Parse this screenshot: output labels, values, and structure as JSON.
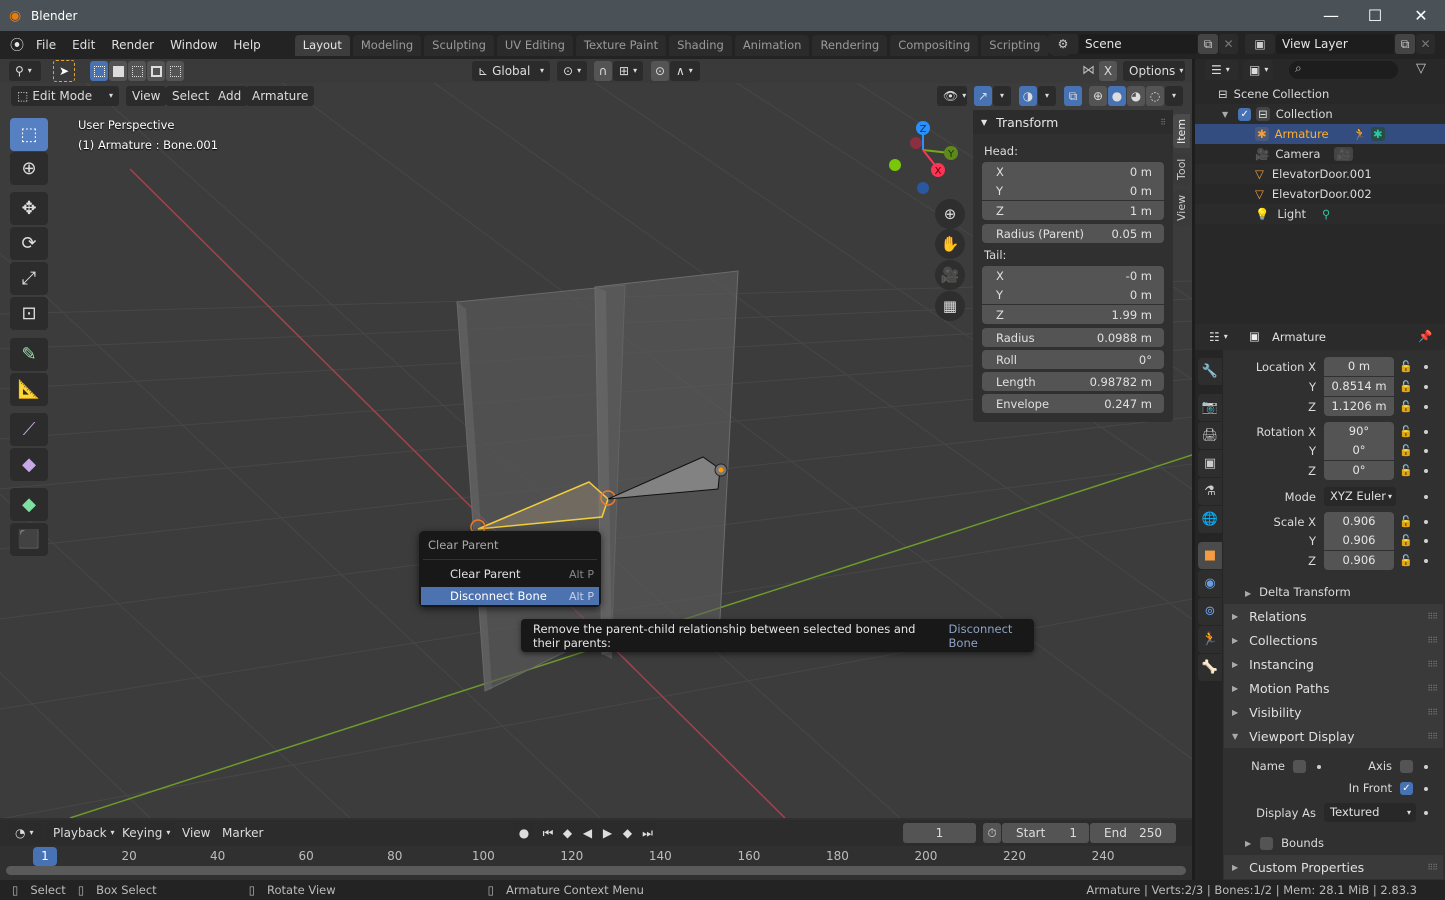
{
  "window": {
    "title": "Blender",
    "controls": [
      "minimize",
      "maximize",
      "close"
    ]
  },
  "menubar": {
    "menus": [
      "File",
      "Edit",
      "Render",
      "Window",
      "Help"
    ],
    "workspaces": [
      "Layout",
      "Modeling",
      "Sculpting",
      "UV Editing",
      "Texture Paint",
      "Shading",
      "Animation",
      "Rendering",
      "Compositing",
      "Scripting"
    ],
    "active_workspace": "Layout",
    "add_workspace": "+",
    "scene": "Scene",
    "view_layer": "View Layer"
  },
  "viewport_header": {
    "transform_orientation": "Global",
    "options_label": "Options",
    "mirror_x": "X",
    "mode": "Edit Mode",
    "menus": [
      "View",
      "Select",
      "Add",
      "Armature"
    ]
  },
  "viewport": {
    "perspective_label": "User Perspective",
    "object_label": "(1) Armature : Bone.001",
    "gizmo_axes": {
      "x": "X",
      "y": "Y",
      "z": "Z",
      "colors": {
        "x": "#ff3352",
        "y": "#8bdc00",
        "z": "#2890ff"
      }
    },
    "nav_buttons": [
      "zoom",
      "pan",
      "camera",
      "grid"
    ]
  },
  "toolbar": {
    "tools": [
      "select-box",
      "cursor",
      "move",
      "rotate",
      "scale",
      "transform",
      "annotate",
      "measure",
      "extrude",
      "extrude-to-cursor",
      "roll",
      "bone-envelope"
    ],
    "active_tool": "select-box"
  },
  "sidebar": {
    "tabs": [
      "Item",
      "Tool",
      "View"
    ],
    "active_tab": "Item",
    "panel_title": "Transform",
    "head_label": "Head:",
    "head": [
      {
        "label": "X",
        "value": "0 m"
      },
      {
        "label": "Y",
        "value": "0 m"
      },
      {
        "label": "Z",
        "value": "1 m"
      }
    ],
    "radius_parent": {
      "label": "Radius (Parent)",
      "value": "0.05 m"
    },
    "tail_label": "Tail:",
    "tail": [
      {
        "label": "X",
        "value": "-0 m"
      },
      {
        "label": "Y",
        "value": "0 m"
      },
      {
        "label": "Z",
        "value": "1.99 m"
      }
    ],
    "radius": {
      "label": "Radius",
      "value": "0.0988 m"
    },
    "roll": {
      "label": "Roll",
      "value": "0°"
    },
    "length": {
      "label": "Length",
      "value": "0.98782 m"
    },
    "envelope": {
      "label": "Envelope",
      "value": "0.247 m"
    }
  },
  "context_menu": {
    "title": "Clear Parent",
    "items": [
      {
        "label": "Clear Parent",
        "shortcut": "Alt P"
      },
      {
        "label": "Disconnect Bone",
        "shortcut": "Alt P",
        "highlighted": true
      }
    ]
  },
  "tooltip": {
    "text": "Remove the parent-child relationship between selected bones and their parents:",
    "python": "Disconnect Bone"
  },
  "outliner": {
    "root": "Scene Collection",
    "collection": "Collection",
    "items": [
      {
        "name": "Armature",
        "selected": true
      },
      {
        "name": "Camera"
      },
      {
        "name": "ElevatorDoor.001"
      },
      {
        "name": "ElevatorDoor.002"
      },
      {
        "name": "Light"
      }
    ]
  },
  "properties": {
    "object_name": "Armature",
    "location": {
      "label": "Location X",
      "x": "0 m",
      "y": "0.8514 m",
      "z": "1.1206 m"
    },
    "rotation": {
      "label": "Rotation X",
      "x": "90°",
      "y": "0°",
      "z": "0°"
    },
    "mode": {
      "label": "Mode",
      "value": "XYZ Euler"
    },
    "scale": {
      "label": "Scale X",
      "x": "0.906",
      "y": "0.906",
      "z": "0.906"
    },
    "axis_labels": {
      "y": "Y",
      "z": "Z"
    },
    "delta_transform": "Delta Transform",
    "sections": [
      "Relations",
      "Collections",
      "Instancing",
      "Motion Paths",
      "Visibility"
    ],
    "viewport_display": {
      "title": "Viewport Display",
      "name_label": "Name",
      "name_checked": false,
      "axis_label": "Axis",
      "axis_checked": false,
      "in_front_label": "In Front",
      "in_front_checked": true,
      "display_as_label": "Display As",
      "display_as": "Textured",
      "bounds_label": "Bounds",
      "bounds_checked": false
    },
    "custom_properties": "Custom Properties"
  },
  "timeline": {
    "menus": [
      "Playback",
      "Keying",
      "View",
      "Marker"
    ],
    "current_frame": "1",
    "start_label": "Start",
    "start": "1",
    "end_label": "End",
    "end": "250",
    "ticks": [
      "20",
      "40",
      "60",
      "80",
      "100",
      "120",
      "140",
      "160",
      "180",
      "200",
      "220",
      "240"
    ],
    "playhead": "1"
  },
  "statusbar": {
    "hints": [
      {
        "label": "Select"
      },
      {
        "label": "Box Select"
      },
      {
        "label": "Rotate View"
      },
      {
        "label": "Armature Context Menu"
      }
    ],
    "info": "Armature | Verts:2/3 | Bones:1/2 | Mem: 28.1 MiB | 2.83.3"
  }
}
